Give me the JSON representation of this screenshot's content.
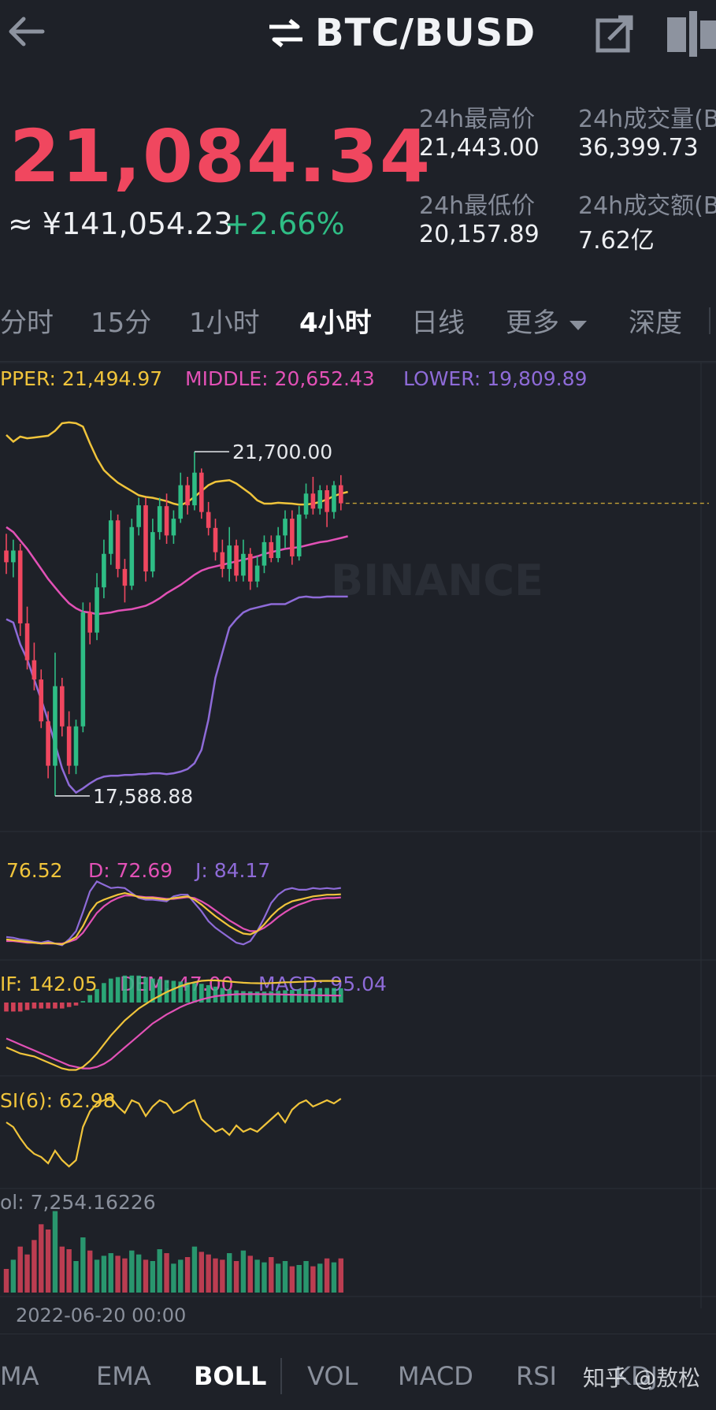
{
  "header": {
    "pair": "BTC/BUSD"
  },
  "ticker": {
    "last_price": "21,084.34",
    "fiat_price": "≈ ¥141,054.23",
    "change_pct": "+2.66%",
    "stats": {
      "high_label": "24h最高价",
      "high_value": "21,443.00",
      "low_label": "24h最低价",
      "low_value": "20,157.89",
      "vol_label": "24h成交量(B",
      "vol_value": "36,399.73",
      "amount_label": "24h成交额(B",
      "amount_value": "7.62亿"
    }
  },
  "intervals": [
    "分时",
    "15分",
    "1小时",
    "4小时",
    "日线",
    "更多",
    "深度"
  ],
  "active_interval": "4小时",
  "boll": {
    "upper": "PPER: 21,494.97",
    "middle": "MIDDLE: 20,652.43",
    "lower": "LOWER: 19,809.89"
  },
  "kdj": {
    "k": "76.52",
    "d": "D: 72.69",
    "j": "J: 84.17"
  },
  "macd": {
    "dif": "IF: 142.05",
    "dem": "DEM: 47.00",
    "macd": "MACD: 95.04"
  },
  "rsi": {
    "label": "SI(6): 62.98"
  },
  "vol": {
    "label": "ol: 7,254.16226"
  },
  "time_label": "2022-06-20 00:00",
  "watermark": "BINANCE",
  "attribution": "知乎 @敖松",
  "indicator_tabs": [
    "MA",
    "EMA",
    "BOLL",
    "VOL",
    "MACD",
    "RSI",
    "KDJ"
  ],
  "active_indicator": "BOLL",
  "colors": {
    "up": "#2ebd85",
    "down": "#f0475f",
    "yellow": "#f0c43b",
    "pink": "#e251b6",
    "purple": "#8e6bd8",
    "background": "#1e2128"
  },
  "chart_data": {
    "type": "candlestick",
    "title": "BTC/BUSD 4小时",
    "annotations": {
      "max": "21,700.00",
      "min": "17,588.88"
    },
    "indicators": [
      "BOLL",
      "KDJ",
      "MACD",
      "RSI",
      "VOL"
    ],
    "candles": [
      {
        "o": 20520,
        "c": 20380,
        "h": 20720,
        "l": 20240
      },
      {
        "o": 20380,
        "c": 20520,
        "h": 20650,
        "l": 20200
      },
      {
        "o": 20520,
        "c": 19650,
        "h": 20600,
        "l": 19500
      },
      {
        "o": 19650,
        "c": 19210,
        "h": 19850,
        "l": 19100
      },
      {
        "o": 19210,
        "c": 18980,
        "h": 19420,
        "l": 18850
      },
      {
        "o": 18980,
        "c": 18480,
        "h": 19100,
        "l": 18400
      },
      {
        "o": 18480,
        "c": 17950,
        "h": 18600,
        "l": 17800
      },
      {
        "o": 17950,
        "c": 18900,
        "h": 19300,
        "l": 17589
      },
      {
        "o": 18900,
        "c": 18420,
        "h": 19000,
        "l": 18300
      },
      {
        "o": 18420,
        "c": 17950,
        "h": 18600,
        "l": 17850
      },
      {
        "o": 17950,
        "c": 18420,
        "h": 18500,
        "l": 17850
      },
      {
        "o": 18420,
        "c": 19780,
        "h": 19900,
        "l": 18350
      },
      {
        "o": 19780,
        "c": 19540,
        "h": 19900,
        "l": 19400
      },
      {
        "o": 19540,
        "c": 20080,
        "h": 20250,
        "l": 19450
      },
      {
        "o": 20080,
        "c": 20480,
        "h": 20650,
        "l": 19950
      },
      {
        "o": 20480,
        "c": 20880,
        "h": 21000,
        "l": 20350
      },
      {
        "o": 20880,
        "c": 20300,
        "h": 20950,
        "l": 20200
      },
      {
        "o": 20300,
        "c": 20100,
        "h": 20420,
        "l": 19900
      },
      {
        "o": 20100,
        "c": 20800,
        "h": 20900,
        "l": 20050
      },
      {
        "o": 20800,
        "c": 21060,
        "h": 21150,
        "l": 20700
      },
      {
        "o": 21060,
        "c": 20270,
        "h": 21150,
        "l": 20150
      },
      {
        "o": 20270,
        "c": 20740,
        "h": 20900,
        "l": 20200
      },
      {
        "o": 20740,
        "c": 21050,
        "h": 21150,
        "l": 20650
      },
      {
        "o": 21050,
        "c": 20700,
        "h": 21200,
        "l": 20600
      },
      {
        "o": 20700,
        "c": 20900,
        "h": 21000,
        "l": 20600
      },
      {
        "o": 20900,
        "c": 21300,
        "h": 21450,
        "l": 20850
      },
      {
        "o": 21300,
        "c": 21060,
        "h": 21400,
        "l": 20950
      },
      {
        "o": 21060,
        "c": 21450,
        "h": 21700,
        "l": 21000
      },
      {
        "o": 21450,
        "c": 20980,
        "h": 21500,
        "l": 20900
      },
      {
        "o": 20980,
        "c": 20790,
        "h": 21100,
        "l": 20700
      },
      {
        "o": 20790,
        "c": 20500,
        "h": 20900,
        "l": 20400
      },
      {
        "o": 20500,
        "c": 20300,
        "h": 20650,
        "l": 20200
      },
      {
        "o": 20300,
        "c": 20580,
        "h": 20800,
        "l": 20150
      },
      {
        "o": 20580,
        "c": 20220,
        "h": 20650,
        "l": 20150
      },
      {
        "o": 20220,
        "c": 20480,
        "h": 20650,
        "l": 20150
      },
      {
        "o": 20480,
        "c": 20150,
        "h": 20550,
        "l": 20050
      },
      {
        "o": 20150,
        "c": 20340,
        "h": 20450,
        "l": 20080
      },
      {
        "o": 20340,
        "c": 20620,
        "h": 20700,
        "l": 20250
      },
      {
        "o": 20620,
        "c": 20430,
        "h": 20700,
        "l": 20380
      },
      {
        "o": 20430,
        "c": 20700,
        "h": 20800,
        "l": 20380
      },
      {
        "o": 20700,
        "c": 20900,
        "h": 21000,
        "l": 20550
      },
      {
        "o": 20900,
        "c": 20450,
        "h": 21000,
        "l": 20350
      },
      {
        "o": 20450,
        "c": 20950,
        "h": 21050,
        "l": 20400
      },
      {
        "o": 20950,
        "c": 21200,
        "h": 21320,
        "l": 20900
      },
      {
        "o": 21200,
        "c": 21020,
        "h": 21400,
        "l": 20950
      },
      {
        "o": 21020,
        "c": 21240,
        "h": 21300,
        "l": 20950
      },
      {
        "o": 21240,
        "c": 20980,
        "h": 21300,
        "l": 20800
      },
      {
        "o": 20980,
        "c": 21300,
        "h": 21350,
        "l": 20900
      },
      {
        "o": 21300,
        "c": 21084,
        "h": 21420,
        "l": 21000
      }
    ],
    "boll_upper": [
      21900,
      21820,
      21880,
      21860,
      21870,
      21880,
      21890,
      21950,
      22040,
      22050,
      22040,
      22000,
      21800,
      21620,
      21480,
      21400,
      21330,
      21280,
      21230,
      21180,
      21160,
      21150,
      21130,
      21110,
      21080,
      21060,
      21100,
      21160,
      21230,
      21300,
      21340,
      21350,
      21360,
      21320,
      21260,
      21200,
      21120,
      21080,
      21080,
      21090,
      21085,
      21080,
      21070,
      21070,
      21080,
      21100,
      21130,
      21170,
      21200,
      21220
    ],
    "boll_middle": [
      20800,
      20740,
      20640,
      20540,
      20420,
      20300,
      20180,
      20080,
      19980,
      19890,
      19830,
      19790,
      19780,
      19760,
      19770,
      19780,
      19800,
      19810,
      19820,
      19840,
      19860,
      19900,
      19950,
      20010,
      20060,
      20110,
      20170,
      20230,
      20280,
      20310,
      20330,
      20350,
      20370,
      20390,
      20410,
      20430,
      20450,
      20480,
      20500,
      20520,
      20540,
      20550,
      20560,
      20580,
      20600,
      20620,
      20630,
      20650,
      20670,
      20690
    ],
    "boll_lower": [
      19700,
      19660,
      19400,
      19220,
      18980,
      18740,
      18490,
      18210,
      17920,
      17720,
      17630,
      17680,
      17740,
      17790,
      17820,
      17830,
      17830,
      17840,
      17840,
      17850,
      17850,
      17860,
      17860,
      17850,
      17860,
      17880,
      17910,
      17980,
      18140,
      18500,
      19000,
      19300,
      19600,
      19700,
      19780,
      19820,
      19840,
      19860,
      19880,
      19880,
      19880,
      19920,
      19960,
      19970,
      19960,
      19960,
      19970,
      19970,
      19970,
      19970
    ],
    "kdj_k": [
      22,
      21,
      20,
      19,
      18,
      17,
      18,
      17,
      16,
      20,
      25,
      38,
      55,
      66,
      70,
      73,
      76,
      78,
      76,
      73,
      72,
      72,
      71,
      70,
      72,
      73,
      74,
      70,
      64,
      57,
      50,
      44,
      38,
      33,
      29,
      28,
      32,
      40,
      50,
      58,
      64,
      68,
      70,
      72,
      74,
      75,
      76,
      76,
      76.5
    ],
    "kdj_d": [
      20,
      20,
      19,
      18,
      18,
      17,
      17,
      17,
      17,
      19,
      22,
      30,
      42,
      54,
      62,
      68,
      72,
      75,
      75,
      74,
      73,
      73,
      72,
      71,
      71,
      72,
      73,
      72,
      68,
      63,
      57,
      51,
      45,
      40,
      35,
      32,
      32,
      36,
      42,
      49,
      55,
      60,
      64,
      67,
      70,
      71,
      72,
      72,
      72.7
    ],
    "kdj_j": [
      25,
      24,
      22,
      21,
      19,
      18,
      20,
      17,
      15,
      22,
      32,
      55,
      80,
      92,
      88,
      84,
      85,
      84,
      78,
      72,
      70,
      70,
      69,
      68,
      74,
      76,
      76,
      66,
      56,
      44,
      36,
      30,
      24,
      18,
      16,
      20,
      32,
      48,
      66,
      76,
      82,
      84,
      82,
      82,
      84,
      83,
      84,
      83,
      84.2
    ],
    "macd_dif": [
      -300,
      -320,
      -340,
      -350,
      -360,
      -380,
      -400,
      -420,
      -440,
      -450,
      -450,
      -430,
      -390,
      -340,
      -280,
      -220,
      -170,
      -120,
      -80,
      -40,
      -10,
      20,
      45,
      70,
      90,
      110,
      125,
      135,
      145,
      148,
      148,
      145,
      140,
      136,
      132,
      130,
      129,
      128,
      130,
      132,
      135,
      136,
      138,
      140,
      142,
      144,
      145,
      144,
      142
    ],
    "macd_dem": [
      -240,
      -260,
      -280,
      -300,
      -320,
      -340,
      -360,
      -380,
      -400,
      -420,
      -430,
      -440,
      -440,
      -430,
      -410,
      -380,
      -340,
      -300,
      -260,
      -220,
      -180,
      -140,
      -110,
      -80,
      -55,
      -30,
      -10,
      5,
      20,
      32,
      42,
      48,
      52,
      55,
      56,
      56,
      56,
      55,
      55,
      54,
      53,
      52,
      51,
      50,
      49,
      48,
      48,
      47,
      47
    ],
    "rsi6": [
      48,
      45,
      38,
      32,
      28,
      26,
      22,
      30,
      24,
      20,
      24,
      45,
      55,
      60,
      62,
      64,
      58,
      54,
      62,
      60,
      52,
      58,
      62,
      60,
      54,
      56,
      60,
      62,
      50,
      46,
      42,
      44,
      40,
      46,
      42,
      44,
      42,
      46,
      50,
      54,
      48,
      56,
      60,
      62,
      58,
      60,
      62,
      60,
      62.98
    ],
    "volume": [
      1800,
      2500,
      3500,
      2900,
      4000,
      5200,
      4800,
      6200,
      3500,
      3300,
      2400,
      4200,
      3200,
      2500,
      2800,
      3000,
      2800,
      2600,
      3200,
      2900,
      2500,
      2400,
      3300,
      3000,
      2200,
      2500,
      2700,
      3500,
      3100,
      2900,
      2600,
      2500,
      3000,
      2400,
      3200,
      2800,
      2500,
      2300,
      2700,
      2200,
      2400,
      2000,
      2100,
      2400,
      2000,
      2200,
      2600,
      2300,
      2600
    ]
  }
}
